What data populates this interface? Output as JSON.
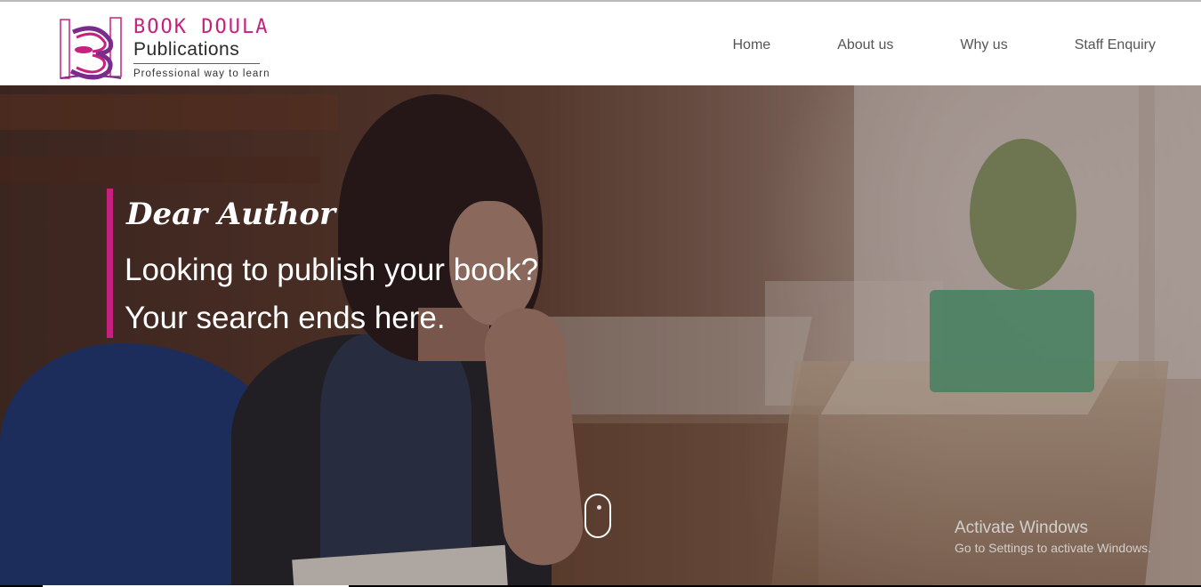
{
  "brand": {
    "name_top": "BOOK DOULA",
    "name_bottom": "Publications",
    "tagline": "Professional way to learn",
    "accent_color": "#c8207e"
  },
  "nav": {
    "items": [
      {
        "label": "Home"
      },
      {
        "label": "About us"
      },
      {
        "label": "Why us"
      },
      {
        "label": "Staff Enquiry"
      }
    ]
  },
  "hero": {
    "title": "Dear Author",
    "line1": "Looking to publish your book?",
    "line2": "Your search ends here.",
    "scroll_icon": "mouse-scroll-icon"
  },
  "system_watermark": {
    "title": "Activate Windows",
    "subtitle": "Go to Settings to activate Windows."
  }
}
